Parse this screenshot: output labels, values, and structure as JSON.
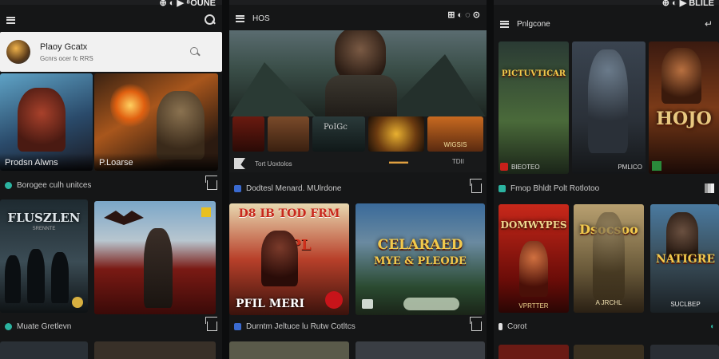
{
  "screen1": {
    "status": "⊕ ◐ ▶ ⁸OUNE",
    "search": {
      "title": "Plaoy Gcatx",
      "subtitle": "Gcnrs ocer fc RRS"
    },
    "featured": [
      {
        "label": "Prodsn Alwns"
      },
      {
        "label": "P.Loarse"
      }
    ],
    "section1": "Borogee culh unitces",
    "row1": [
      {
        "title": "FLUSZLEN",
        "subtitle": "SRENNTE"
      },
      {
        "title": ""
      }
    ],
    "section2": "Muate Gretlevn"
  },
  "screen2": {
    "status": "⊞ ◐ ◌ ⊙",
    "header": "HOS",
    "thumb_labels": [
      "PoIGc",
      "WIGSIS"
    ],
    "caption_left": "Tort Uoxtolos",
    "caption_right": "TDII",
    "section1": "Dodtesl Menard. MUlrdone",
    "row1": [
      {
        "title": "D8 IB TOD FRM",
        "subtitle": "POPL",
        "bottom": "PFIL MERI"
      },
      {
        "title": "CELARAED",
        "subtitle": "MYE & PLEODE",
        "bottom": ""
      }
    ],
    "section2": "Durntm Jeltuce lu Rutw Cotltcs"
  },
  "screen3": {
    "status": "⊕ ◐ ▶ BLILE",
    "header": "Pnlgcone",
    "featured": [
      {
        "title": "PICTUVTICAR",
        "label": "BIEOTEO"
      },
      {
        "title": "",
        "label": "PMLICO"
      },
      {
        "title": "HOJO",
        "label": ""
      }
    ],
    "section1": "Fmop Bhldt Polt Rotlotoo",
    "row1": [
      {
        "title": "DOMWYPES",
        "subtitle": "VPRTTER"
      },
      {
        "title": "Dsocsoo",
        "subtitle": "A JRCHL"
      },
      {
        "title": "NATIGRE",
        "subtitle": "SUCLBEP"
      }
    ],
    "section2": "Corot"
  }
}
